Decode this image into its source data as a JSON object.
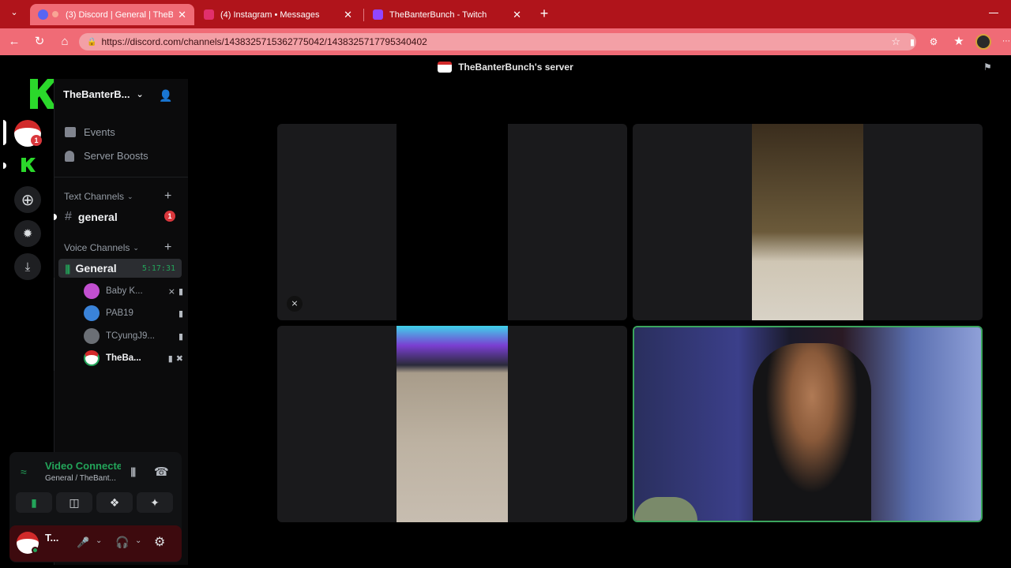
{
  "tabs": [
    {
      "title": "(3) Discord | General | TheBan"
    },
    {
      "title": "(4) Instagram • Messages"
    },
    {
      "title": "TheBanterBunch - Twitch"
    }
  ],
  "browser": {
    "url": "https://discord.com/channels/1438325715362775042/1438325717795340402"
  },
  "title_bar": {
    "server_name": "TheBanterBunch's server"
  },
  "overlay": {
    "logo_text": "3"
  },
  "sidebar": {
    "server_name": "TheBanterB...",
    "items": [
      {
        "label": "Events"
      },
      {
        "label": "Server Boosts"
      }
    ],
    "text_category": "Text Channels",
    "text_channel": {
      "name": "general",
      "badge": "1"
    },
    "voice_category": "Voice Channels",
    "voice_channel": {
      "name": "General",
      "timer": "5:17:31"
    },
    "voice_users": [
      {
        "name": "Baby K...",
        "color": "#c24fd0"
      },
      {
        "name": "PAB19",
        "color": "#3a83d9"
      },
      {
        "name": "TCyungJ9...",
        "color": "#6b6f75"
      },
      {
        "name": "TheBa...",
        "color": "#d12a2a"
      }
    ]
  },
  "rail": {
    "server_badge": "1"
  },
  "voice_panel": {
    "status": "Video Connecte",
    "channel": "General / TheBant..."
  },
  "user_panel": {
    "name": "T..."
  },
  "colors": {
    "accent": "#23a55a",
    "tab_bar": "#b0141b",
    "toolbar": "#f06b76",
    "badge": "#da373c",
    "speaking_outline": "#3ba55d"
  }
}
